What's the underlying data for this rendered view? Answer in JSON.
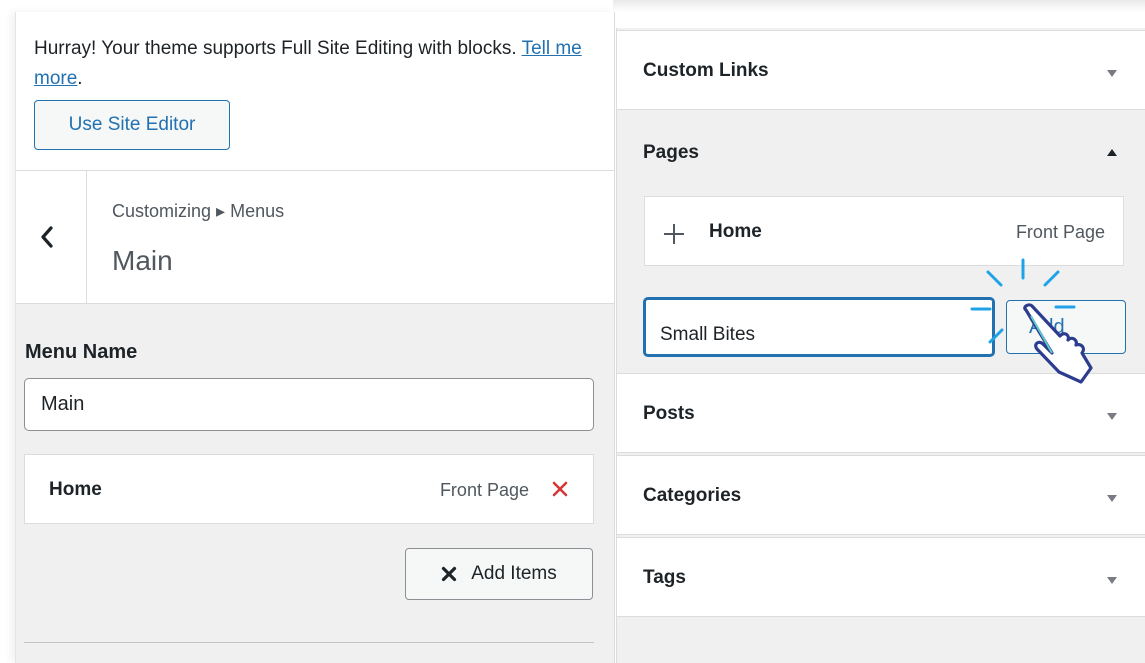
{
  "notice": {
    "text": "Hurray! Your theme supports Full Site Editing with blocks.",
    "link": "Tell me more",
    "trailing": ".",
    "button": "Use Site Editor"
  },
  "panel": {
    "breadcrumb": "Customizing ▸ Menus",
    "title": "Main"
  },
  "menu": {
    "name_label": "Menu Name",
    "name_value": "Main",
    "items": [
      {
        "title": "Home",
        "type": "Front Page"
      }
    ],
    "add_items": "Add Items"
  },
  "add_menu_items": {
    "sections": {
      "custom_links": "Custom Links",
      "pages": "Pages",
      "posts": "Posts",
      "categories": "Categories",
      "tags": "Tags"
    },
    "pages_expanded": true,
    "page_items": [
      {
        "title": "Home",
        "type": "Front Page"
      }
    ],
    "new_page_value": "Small Bites",
    "add_button": "Add"
  },
  "colors": {
    "accent": "#2271b1",
    "remove": "#d63638",
    "cursor_highlight": "#1fa3e8"
  },
  "icons": {
    "back": "chevron-left-icon",
    "remove": "close-icon",
    "add_items": "close-icon",
    "collapsed": "triangle-down-icon",
    "expanded": "triangle-up-icon",
    "page_add": "plus-icon",
    "cursor": "hand-pointer-icon"
  }
}
